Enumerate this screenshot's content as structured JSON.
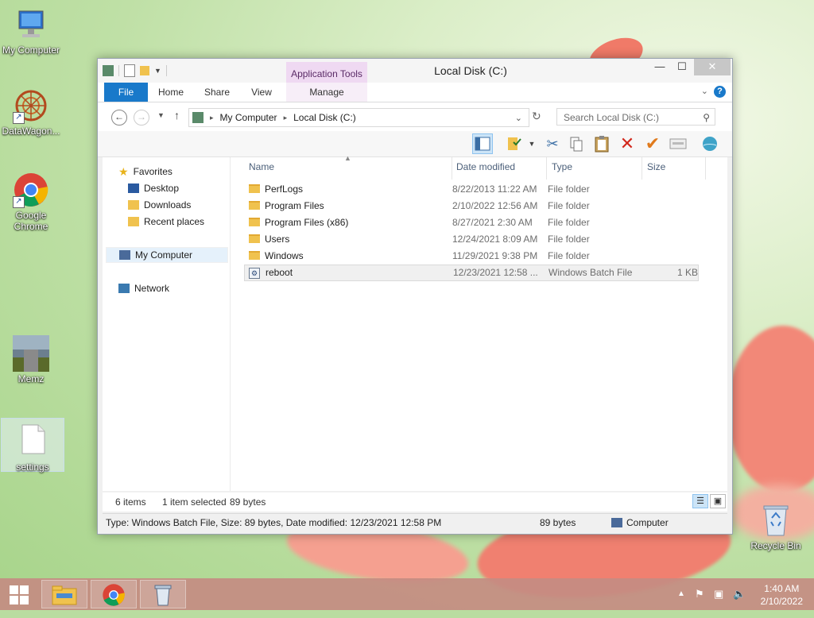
{
  "desktop": {
    "icons": [
      {
        "label": "My Computer"
      },
      {
        "label": "DataWagon..."
      },
      {
        "label": "Google Chrome"
      },
      {
        "label": "Memz"
      },
      {
        "label": "settings"
      },
      {
        "label": "Recycle Bin"
      }
    ]
  },
  "window": {
    "title": "Local Disk (C:)",
    "context_tab_header": "Application Tools",
    "ribbon_tabs": [
      "File",
      "Home",
      "Share",
      "View",
      "Manage"
    ],
    "help": "?",
    "address": {
      "root": "My Computer",
      "current": "Local Disk (C:)"
    },
    "search_placeholder": "Search Local Disk (C:)"
  },
  "navpane": {
    "favorites": "Favorites",
    "favorite_items": [
      "Desktop",
      "Downloads",
      "Recent places"
    ],
    "my_computer": "My Computer",
    "network": "Network"
  },
  "columns": {
    "name": "Name",
    "date": "Date modified",
    "type": "Type",
    "size": "Size"
  },
  "files": [
    {
      "name": "PerfLogs",
      "date": "8/22/2013 11:22 AM",
      "type": "File folder",
      "size": "",
      "kind": "folder"
    },
    {
      "name": "Program Files",
      "date": "2/10/2022 12:56 AM",
      "type": "File folder",
      "size": "",
      "kind": "folder"
    },
    {
      "name": "Program Files (x86)",
      "date": "8/27/2021 2:30 AM",
      "type": "File folder",
      "size": "",
      "kind": "folder"
    },
    {
      "name": "Users",
      "date": "12/24/2021 8:09 AM",
      "type": "File folder",
      "size": "",
      "kind": "folder"
    },
    {
      "name": "Windows",
      "date": "11/29/2021 9:38 PM",
      "type": "File folder",
      "size": "",
      "kind": "folder"
    },
    {
      "name": "reboot",
      "date": "12/23/2021 12:58 ...",
      "type": "Windows Batch File",
      "size": "1 KB",
      "kind": "batch"
    }
  ],
  "status": {
    "items": "6 items",
    "selected": "1 item selected",
    "bytes": "89 bytes"
  },
  "details": {
    "text": "Type: Windows Batch File, Size: 89 bytes, Date modified: 12/23/2021 12:58 PM",
    "size": "89 bytes",
    "location": "Computer"
  },
  "taskbar": {
    "clock_time": "1:40 AM",
    "clock_date": "2/10/2022"
  }
}
